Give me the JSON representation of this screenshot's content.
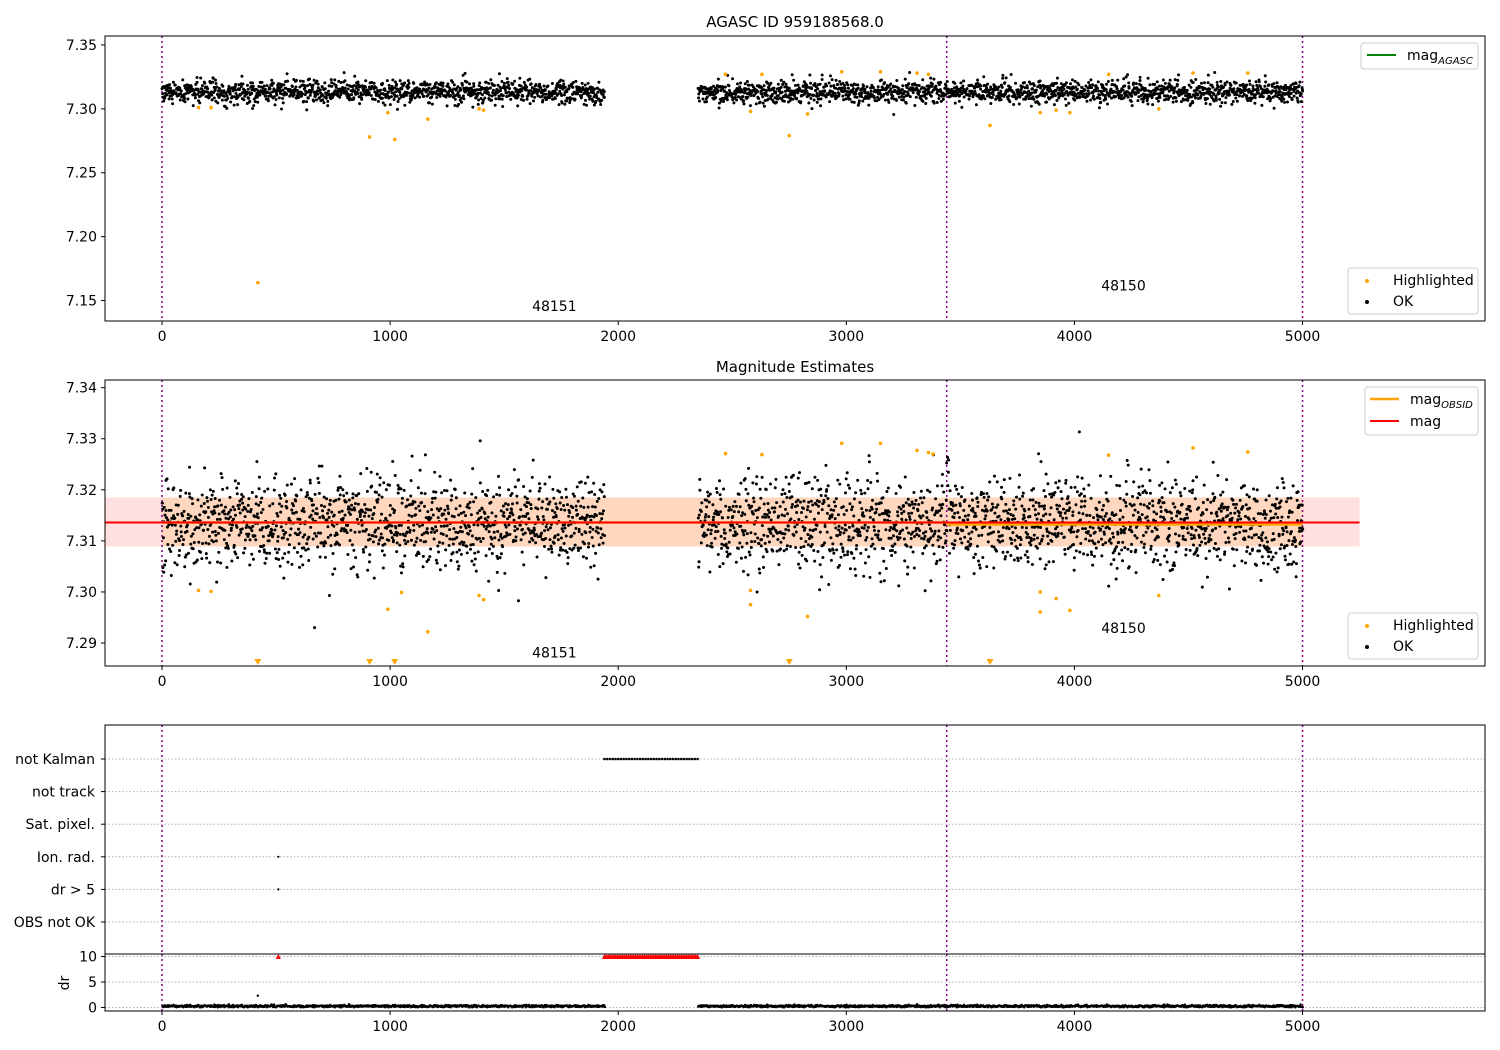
{
  "chart_data": [
    {
      "type": "scatter",
      "title": "AGASC ID 959188568.0",
      "xlim": [
        -250,
        5800
      ],
      "ylim": [
        7.134,
        7.357
      ],
      "x_ticks": [
        0,
        1000,
        2000,
        3000,
        4000,
        5000
      ],
      "y_ticks": [
        7.15,
        7.2,
        7.25,
        7.3,
        7.35
      ],
      "obsid_boundaries": [
        0,
        3440,
        5000
      ],
      "obsid_labels": [
        {
          "text": "48151",
          "x": 1720,
          "y": 7.142
        },
        {
          "text": "48150",
          "x": 4215,
          "y": 7.158
        }
      ],
      "legend_lines": [
        {
          "label": "mag",
          "subscript": "AGASC",
          "color": "#008000"
        }
      ],
      "legend_points": [
        {
          "label": "Highlighted",
          "color": "#ffa500"
        },
        {
          "label": "OK",
          "color": "#000000"
        }
      ],
      "ok_series": {
        "name": "OK",
        "segments": [
          {
            "x_start": 0,
            "x_end": 1940
          },
          {
            "x_start": 2350,
            "x_end": 5000
          }
        ],
        "center": 7.3135,
        "spread": 0.0045
      },
      "highlighted": [
        {
          "x": 160,
          "y": 7.301
        },
        {
          "x": 215,
          "y": 7.301
        },
        {
          "x": 420,
          "y": 7.164
        },
        {
          "x": 910,
          "y": 7.278
        },
        {
          "x": 990,
          "y": 7.297
        },
        {
          "x": 1020,
          "y": 7.276
        },
        {
          "x": 1165,
          "y": 7.292
        },
        {
          "x": 1390,
          "y": 7.3
        },
        {
          "x": 1410,
          "y": 7.299
        },
        {
          "x": 2470,
          "y": 7.327
        },
        {
          "x": 2580,
          "y": 7.298
        },
        {
          "x": 2630,
          "y": 7.327
        },
        {
          "x": 2750,
          "y": 7.279
        },
        {
          "x": 2830,
          "y": 7.296
        },
        {
          "x": 2980,
          "y": 7.329
        },
        {
          "x": 3150,
          "y": 7.329
        },
        {
          "x": 3310,
          "y": 7.328
        },
        {
          "x": 3360,
          "y": 7.327
        },
        {
          "x": 3630,
          "y": 7.287
        },
        {
          "x": 3850,
          "y": 7.297
        },
        {
          "x": 3920,
          "y": 7.299
        },
        {
          "x": 3980,
          "y": 7.297
        },
        {
          "x": 4150,
          "y": 7.327
        },
        {
          "x": 4370,
          "y": 7.3
        },
        {
          "x": 4520,
          "y": 7.328
        },
        {
          "x": 4760,
          "y": 7.328
        }
      ]
    },
    {
      "type": "scatter",
      "title": "Magnitude Estimates",
      "xlim": [
        -250,
        5800
      ],
      "ylim": [
        7.2855,
        7.3415
      ],
      "x_ticks": [
        0,
        1000,
        2000,
        3000,
        4000,
        5000
      ],
      "y_ticks": [
        7.29,
        7.3,
        7.31,
        7.32,
        7.33,
        7.34
      ],
      "obsid_boundaries": [
        0,
        3440,
        5000
      ],
      "obsid_labels": [
        {
          "text": "48151",
          "x": 1720,
          "y": 7.2872
        },
        {
          "text": "48150",
          "x": 4215,
          "y": 7.292
        }
      ],
      "mag_line": {
        "value": 7.3136,
        "x_range": [
          -250,
          5250
        ],
        "band": [
          7.3089,
          7.3185
        ],
        "color": "#ff0000"
      },
      "obsid_lines": [
        {
          "x_range": [
            0,
            3440
          ],
          "value": 7.3136
        },
        {
          "x_range": [
            3440,
            5000
          ],
          "value": 7.3132
        }
      ],
      "legend_lines": [
        {
          "label": "mag",
          "subscript": "OBSID",
          "color": "#ffa500"
        },
        {
          "label": "mag",
          "subscript": "",
          "color": "#ff0000"
        }
      ],
      "legend_points": [
        {
          "label": "Highlighted",
          "color": "#ffa500"
        },
        {
          "label": "OK",
          "color": "#000000"
        }
      ],
      "ok_series": {
        "name": "OK",
        "segments": [
          {
            "x_start": 0,
            "x_end": 1940
          },
          {
            "x_start": 2350,
            "x_end": 5000
          }
        ],
        "center": 7.3135,
        "spread": 0.0045
      },
      "highlighted": [
        {
          "x": 160,
          "y": 7.3003
        },
        {
          "x": 215,
          "y": 7.3001
        },
        {
          "x": 990,
          "y": 7.2966
        },
        {
          "x": 1050,
          "y": 7.2999
        },
        {
          "x": 1165,
          "y": 7.2922
        },
        {
          "x": 1390,
          "y": 7.2993
        },
        {
          "x": 1410,
          "y": 7.2985
        },
        {
          "x": 2470,
          "y": 7.3271
        },
        {
          "x": 2580,
          "y": 7.3003
        },
        {
          "x": 2580,
          "y": 7.2975
        },
        {
          "x": 2630,
          "y": 7.3269
        },
        {
          "x": 2830,
          "y": 7.2952
        },
        {
          "x": 2980,
          "y": 7.3291
        },
        {
          "x": 3150,
          "y": 7.3291
        },
        {
          "x": 3310,
          "y": 7.3277
        },
        {
          "x": 3360,
          "y": 7.3273
        },
        {
          "x": 3380,
          "y": 7.327
        },
        {
          "x": 3850,
          "y": 7.2961
        },
        {
          "x": 3850,
          "y": 7.3
        },
        {
          "x": 3920,
          "y": 7.2987
        },
        {
          "x": 3980,
          "y": 7.2964
        },
        {
          "x": 4150,
          "y": 7.3268
        },
        {
          "x": 4370,
          "y": 7.2993
        },
        {
          "x": 4520,
          "y": 7.3282
        },
        {
          "x": 4760,
          "y": 7.3274
        }
      ],
      "off_scale_markers": [
        {
          "x": 420
        },
        {
          "x": 910
        },
        {
          "x": 1020
        },
        {
          "x": 2750
        },
        {
          "x": 3630
        }
      ]
    },
    {
      "type": "scatter",
      "title": "",
      "xlim": [
        -250,
        5800
      ],
      "x_ticks": [
        0,
        1000,
        2000,
        3000,
        4000,
        5000
      ],
      "obsid_boundaries": [
        0,
        3440,
        5000
      ],
      "flag_rows": [
        "not Kalman",
        "not track",
        "Sat. pixel.",
        "Ion. rad.",
        "dr > 5",
        "OBS not OK"
      ],
      "flag_points": [
        {
          "row": "not Kalman",
          "x_start": 1940,
          "x_end": 2350
        },
        {
          "row": "Ion. rad.",
          "x": 510
        },
        {
          "row": "dr > 5",
          "x": 510
        }
      ]
    },
    {
      "type": "scatter",
      "title": "",
      "ylabel": "dr",
      "xlim": [
        -250,
        5800
      ],
      "ylim": [
        -0.7,
        10.5
      ],
      "x_ticks": [
        0,
        1000,
        2000,
        3000,
        4000,
        5000
      ],
      "y_ticks": [
        0,
        5,
        10
      ],
      "obsid_boundaries": [
        0,
        3440,
        5000
      ],
      "dr_series": {
        "segments": [
          {
            "x_start": 0,
            "x_end": 1940
          },
          {
            "x_start": 2350,
            "x_end": 5000
          }
        ],
        "center": 0.25,
        "spread": 0.12,
        "outliers": [
          {
            "x": 420,
            "y": 2.3
          }
        ]
      },
      "clipped": [
        {
          "x": 510,
          "y": 10
        },
        {
          "x_start": 1940,
          "x_end": 2350,
          "y": 10
        }
      ]
    }
  ]
}
